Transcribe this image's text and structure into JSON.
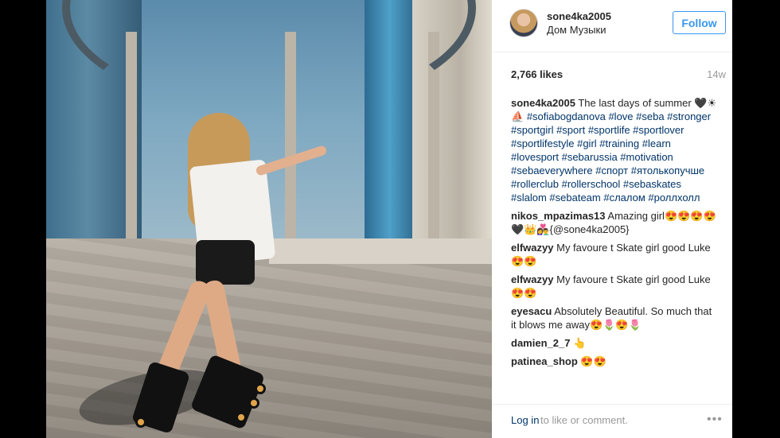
{
  "post": {
    "username": "sone4ka2005",
    "location": "Дом Музыки",
    "follow_label": "Follow",
    "likes": "2,766 likes",
    "age": "14w"
  },
  "caption": {
    "username": "sone4ka2005",
    "text": "The last days of summer 🖤☀⛵",
    "hashtags": "#sofiabogdanova #love #seba #stronger #sportgirl #sport #sportlife #sportlover #sportlifestyle #girl #training #learn #lovesport #sebarussia #motivation #sebaeverywhere #спорт #ятолькопучше #rollerclub #rollerschool #sebaskates #slalom #sebateam #слалом #роллхолл"
  },
  "comments": [
    {
      "user": "nikos_mpazimas13",
      "text": "Amazing girl😍😍😍😍🖤👑👩‍❤️‍👨{@sone4ka2005}"
    },
    {
      "user": "elfwazyy",
      "text": "My favoure t Skate girl good Luke 😍😍"
    },
    {
      "user": "elfwazyy",
      "text": "My favoure t Skate girl good Luke 😍😍"
    },
    {
      "user": "eyesacu",
      "text": "Absolutely Beautiful. So much that it blows me away😍🌷😍🌷"
    },
    {
      "user": "damien_2_7",
      "text": "👆"
    },
    {
      "user": "patinea_shop",
      "text": "😍😍"
    }
  ],
  "footer": {
    "login_label": "Log in",
    "login_rest": "to like or comment.",
    "more_icon": "•••"
  },
  "icons": {
    "more": "more-options-icon"
  },
  "colors": {
    "link": "#003569",
    "accent": "#3897f0",
    "muted": "#999999"
  }
}
